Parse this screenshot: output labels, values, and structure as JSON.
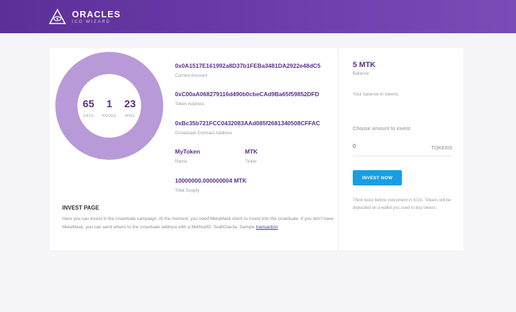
{
  "brand": {
    "title": "ORACLES",
    "subtitle": "ICO WIZARD"
  },
  "countdown": {
    "days": {
      "value": "65",
      "label": "DAYS"
    },
    "hours": {
      "value": "1",
      "label": "HOURS"
    },
    "mins": {
      "value": "23",
      "label": "MINS"
    }
  },
  "info": {
    "current_account": {
      "value": "0x0A1517E161992a8D37b1FEBa3481DA2922e48dC5",
      "label": "Current Account"
    },
    "token_address": {
      "value": "0xC00aA068279116d490b0cbeCAd9Ba65f59852DFD",
      "label": "Token Address"
    },
    "crowdsale_address": {
      "value": "0xBc35b721FCC0432083AAd085f2681340508CFFAC",
      "label": "Crowdsale Contract Address"
    },
    "name": {
      "value": "MyToken",
      "label": "Name"
    },
    "ticker": {
      "value": "MTK",
      "label": "Ticker"
    },
    "total_supply": {
      "value": "10000000.000000004 MTK",
      "label": "Total Supply"
    }
  },
  "invest": {
    "title": "INVEST PAGE",
    "text": "Here you can invest in the crowdsale campaign. At the moment, you need MetaMask client to invest into the crowdsale. If you don't have MetaMask, you can send ethers to the crowdsale address with a MethodID: 0xa6f2ae3a. Sample",
    "link": "transaction"
  },
  "balance": {
    "value": "5 MTK",
    "label": "Balance",
    "description": "Your balance in tokens."
  },
  "purchase": {
    "choose_label": "Choose amount to invest",
    "amount": "0",
    "unit": "TOKENS",
    "button": "INVEST NOW",
    "note": "Think twice before investment in ICOs. Tokens will be deposited on a wallet you used to buy tokens."
  },
  "colors": {
    "header": "#6a3aa8",
    "accent": "#5b2f8e",
    "ring": "#b89ad8",
    "button": "#1a9de3"
  }
}
